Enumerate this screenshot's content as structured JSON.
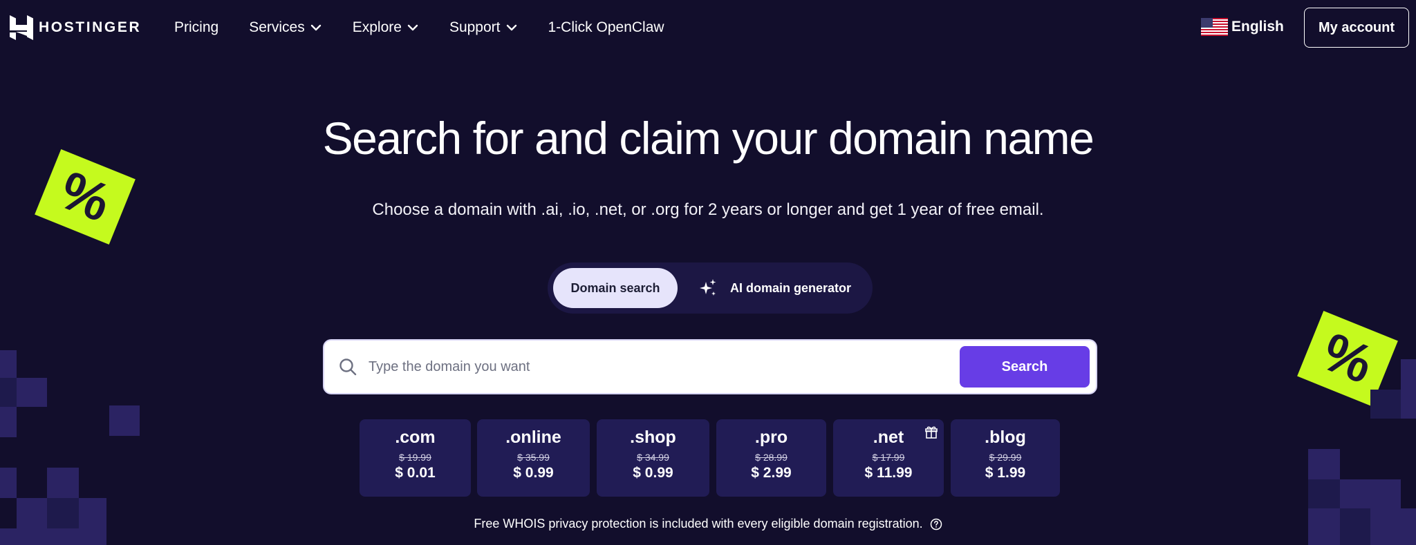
{
  "brand": {
    "name": "HOSTINGER"
  },
  "nav": [
    {
      "label": "Pricing",
      "dropdown": false
    },
    {
      "label": "Services",
      "dropdown": true
    },
    {
      "label": "Explore",
      "dropdown": true
    },
    {
      "label": "Support",
      "dropdown": true
    },
    {
      "label": "1-Click OpenClaw",
      "dropdown": false
    }
  ],
  "language": {
    "label": "English",
    "icon": "us-flag-icon"
  },
  "account": {
    "label": "My account"
  },
  "hero": {
    "title": "Search for and claim your domain name",
    "subtitle": "Choose a domain with .ai, .io, .net, or .org for 2 years or longer and get 1 year of free email."
  },
  "tabs": {
    "domain_search": "Domain search",
    "ai_generator": "AI domain generator"
  },
  "search": {
    "placeholder": "Type the domain you want",
    "button": "Search"
  },
  "tlds": [
    {
      "name": ".com",
      "old_price": "$ 19.99",
      "price": "$ 0.01"
    },
    {
      "name": ".online",
      "old_price": "$ 35.99",
      "price": "$ 0.99"
    },
    {
      "name": ".shop",
      "old_price": "$ 34.99",
      "price": "$ 0.99"
    },
    {
      "name": ".pro",
      "old_price": "$ 28.99",
      "price": "$ 2.99"
    },
    {
      "name": ".net",
      "old_price": "$ 17.99",
      "price": "$ 11.99",
      "gift": true
    },
    {
      "name": ".blog",
      "old_price": "$ 29.99",
      "price": "$ 1.99"
    }
  ],
  "whois_note": "Free WHOIS privacy protection is included with every eligible domain registration.",
  "colors": {
    "background": "#120e2c",
    "accent": "#673de6",
    "card": "#211c55",
    "sticker": "#c5fa1e"
  },
  "stickers": {
    "symbol": "%"
  }
}
